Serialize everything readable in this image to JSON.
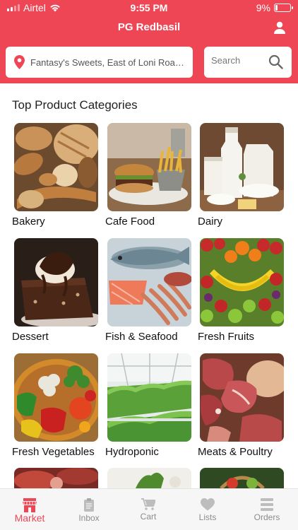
{
  "status_bar": {
    "carrier": "Airtel",
    "time": "9:55 PM",
    "battery": "9%"
  },
  "header": {
    "title": "PG Redbasil"
  },
  "location": {
    "text": "Fantasy's Sweets, East of Loni Road..."
  },
  "search": {
    "placeholder": "Search"
  },
  "section": {
    "title": "Top Product Categories"
  },
  "categories": [
    {
      "label": "Bakery"
    },
    {
      "label": "Cafe Food"
    },
    {
      "label": "Dairy"
    },
    {
      "label": "Dessert"
    },
    {
      "label": "Fish & Seafood"
    },
    {
      "label": "Fresh Fruits"
    },
    {
      "label": "Fresh Vegetables"
    },
    {
      "label": "Hydroponic"
    },
    {
      "label": "Meats & Poultry"
    }
  ],
  "tabs": [
    {
      "label": "Market",
      "active": true
    },
    {
      "label": "Inbox"
    },
    {
      "label": "Cart"
    },
    {
      "label": "Lists"
    },
    {
      "label": "Orders"
    }
  ],
  "colors": {
    "accent": "#ef4655",
    "inactive_tab": "#8c8c8c",
    "tabbar_bg": "#f6f6f6"
  }
}
